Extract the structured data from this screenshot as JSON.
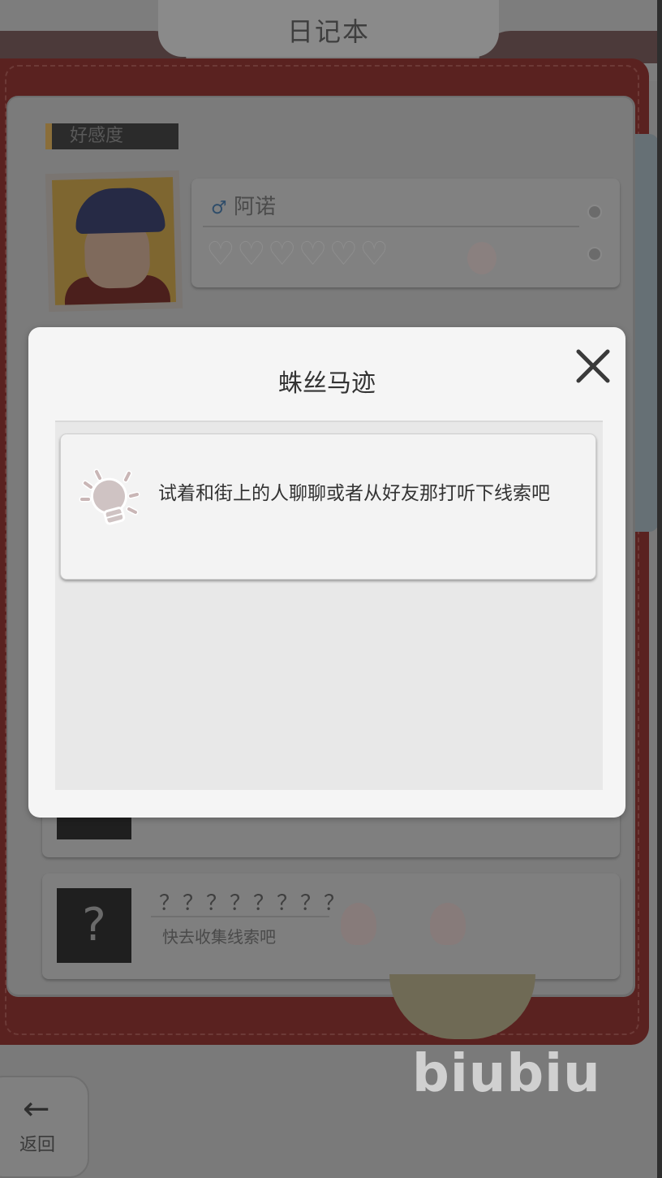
{
  "app": {
    "title": "日记本"
  },
  "background": {
    "favorability_label": "好感度",
    "character": {
      "name": "阿诺",
      "gender_symbol": "♂",
      "hearts": "♡♡♡♡♡♡"
    },
    "unknown_entry": {
      "name": "？？？？？？？？",
      "hint": "快去收集线索吧",
      "box_symbol": "?"
    },
    "back_button": {
      "arrow": "←",
      "label": "返回"
    }
  },
  "watermark": "biubiu",
  "modal": {
    "title": "蛛丝马迹",
    "close_icon": "close-icon",
    "hint": {
      "icon": "lightbulb-icon",
      "text": "试着和街上的人聊聊或者从好友那打听下线索吧"
    }
  },
  "colors": {
    "overlay": "#7a7a7a",
    "modal_bg": "#f5f5f5",
    "modal_body_bg": "#e8e8e8",
    "bulb": "#cfc3c3"
  }
}
